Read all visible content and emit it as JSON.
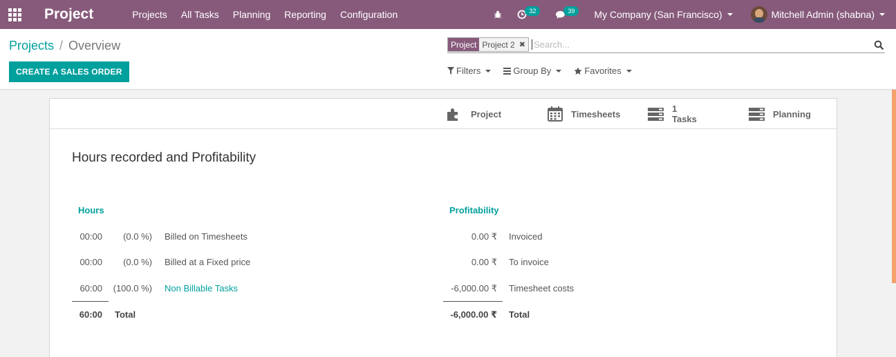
{
  "navbar": {
    "app_title": "Project",
    "menu": [
      "Projects",
      "All Tasks",
      "Planning",
      "Reporting",
      "Configuration"
    ],
    "activity_count": "32",
    "messages_count": "39",
    "company": "My Company (San Francisco)",
    "user": "Mitchell Admin (shabna)",
    "color": "#875a7b"
  },
  "control": {
    "breadcrumb_parent": "Projects",
    "breadcrumb_separator": "/",
    "breadcrumb_current": "Overview",
    "primary_button": "CREATE A SALES ORDER",
    "search": {
      "facet_category": "Project",
      "facet_value": "Project 2",
      "placeholder": "Search..."
    },
    "filters_label": "Filters",
    "group_by_label": "Group By",
    "favorites_label": "Favorites"
  },
  "smart_buttons": {
    "project": "Project",
    "timesheets": "Timesheets",
    "tasks_count": "1",
    "tasks_label": "Tasks",
    "planning": "Planning"
  },
  "overview": {
    "title": "Hours recorded and Profitability",
    "hours": {
      "header": "Hours",
      "rows": [
        {
          "time": "00:00",
          "pct": "(0.0 %)",
          "label": "Billed on Timesheets"
        },
        {
          "time": "00:00",
          "pct": "(0.0 %)",
          "label": "Billed at a Fixed price"
        },
        {
          "time": "60:00",
          "pct": "(100.0 %)",
          "label": "Non Billable Tasks"
        }
      ],
      "total_value": "60:00",
      "total_label": "Total"
    },
    "profitability": {
      "header": "Profitability",
      "rows": [
        {
          "amount": "0.00 ₹",
          "label": "Invoiced"
        },
        {
          "amount": "0.00 ₹",
          "label": "To invoice"
        },
        {
          "amount": "-6,000.00 ₹",
          "label": "Timesheet costs"
        }
      ],
      "total_value": "-6,000.00 ₹",
      "total_label": "Total"
    },
    "accent_color": "#00a09d"
  }
}
